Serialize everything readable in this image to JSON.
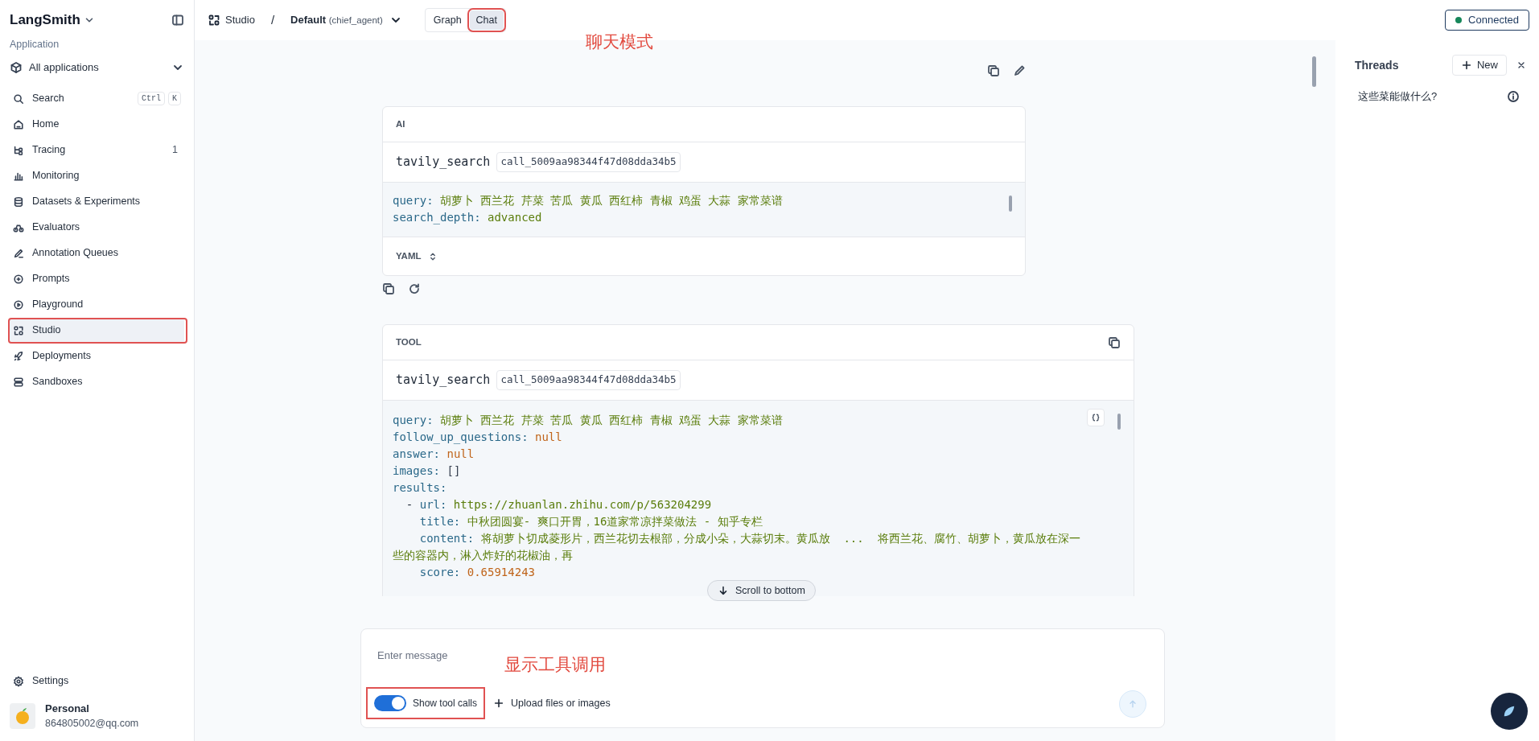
{
  "sidebar": {
    "brand": "LangSmith",
    "section_label": "Application",
    "app_selector": "All applications",
    "items": [
      {
        "label": "Search",
        "kind": "search",
        "shortcut": [
          "Ctrl",
          "K"
        ],
        "selected": false,
        "highlighted": false
      },
      {
        "label": "Home",
        "kind": "home",
        "selected": false,
        "highlighted": false
      },
      {
        "label": "Tracing",
        "kind": "tracing",
        "count": "1",
        "selected": false,
        "highlighted": false
      },
      {
        "label": "Monitoring",
        "kind": "chart",
        "selected": false,
        "highlighted": false
      },
      {
        "label": "Datasets & Experiments",
        "kind": "database",
        "selected": false,
        "highlighted": false
      },
      {
        "label": "Evaluators",
        "kind": "evaluator",
        "selected": false,
        "highlighted": false
      },
      {
        "label": "Annotation Queues",
        "kind": "pen",
        "selected": false,
        "highlighted": false
      },
      {
        "label": "Prompts",
        "kind": "prompt",
        "selected": false,
        "highlighted": false
      },
      {
        "label": "Playground",
        "kind": "play",
        "selected": false,
        "highlighted": false
      },
      {
        "label": "Studio",
        "kind": "studio",
        "selected": true,
        "highlighted": true
      },
      {
        "label": "Deployments",
        "kind": "rocket",
        "selected": false,
        "highlighted": false
      },
      {
        "label": "Sandboxes",
        "kind": "sandbox",
        "selected": false,
        "highlighted": false
      }
    ],
    "settings": "Settings",
    "account": {
      "name": "Personal",
      "email": "864805002@qq.com"
    }
  },
  "topbar": {
    "breadcrumb": "Studio",
    "separator": "/",
    "graph_name": "Default",
    "graph_id": "(chief_agent)",
    "tabs": [
      {
        "label": "Graph",
        "selected": false,
        "highlighted": false
      },
      {
        "label": "Chat",
        "selected": true,
        "highlighted": true
      }
    ],
    "status": "Connected"
  },
  "annotations": [
    {
      "text": "聊天模式"
    },
    {
      "text": "显示工具调用"
    }
  ],
  "messages": [
    {
      "role": "AI",
      "tool": "tavily_search",
      "call_id": "call_5009aa98344f47d08dda34b5",
      "format": "YAML",
      "lines": [
        {
          "key": "query:",
          "value": "胡萝卜 西兰花 芹菜 苦瓜 黄瓜 西红柿 青椒 鸡蛋 大蒜 家常菜谱",
          "kind": "string"
        },
        {
          "key": "search_depth:",
          "value": "advanced",
          "kind": "string"
        }
      ]
    },
    {
      "role": "TOOL",
      "tool": "tavily_search",
      "call_id": "call_5009aa98344f47d08dda34b5",
      "lines": [
        {
          "key": "query:",
          "value": "胡萝卜 西兰花 芹菜 苦瓜 黄瓜 西红柿 青椒 鸡蛋 大蒜 家常菜谱",
          "kind": "string"
        },
        {
          "key": "follow_up_questions:",
          "value": "null",
          "kind": "null"
        },
        {
          "key": "answer:",
          "value": "null",
          "kind": "null"
        },
        {
          "key": "images:",
          "value": "[]",
          "kind": "plain"
        },
        {
          "key": "results:",
          "children": [
            {
              "marker": "-",
              "key": "url:",
              "value": "https://zhuanlan.zhihu.com/p/563204299",
              "kind": "string"
            },
            {
              "key": "title:",
              "value": "中秋团圆宴- 爽口开胃，16道家常凉拌菜做法 - 知乎专栏",
              "kind": "string"
            },
            {
              "key": "content:",
              "value": "将胡萝卜切成菱形片，西兰花切去根部，分成小朵，大蒜切末。黄瓜放  ...  将西兰花、腐竹、胡萝卜，黄瓜放在深一些的容器内，淋入炸好的花椒油，再",
              "kind": "string"
            },
            {
              "key": "score:",
              "value": "0.65914243",
              "kind": "number"
            }
          ]
        }
      ]
    }
  ],
  "scroll_button": "Scroll to bottom",
  "composer": {
    "placeholder": "Enter message",
    "toggle": {
      "label": "Show tool calls",
      "on": true,
      "highlighted": true
    },
    "upload": "Upload files or images"
  },
  "threads": {
    "title": "Threads",
    "new_button": "New",
    "items": [
      {
        "title": "这些菜能做什么?"
      }
    ]
  }
}
